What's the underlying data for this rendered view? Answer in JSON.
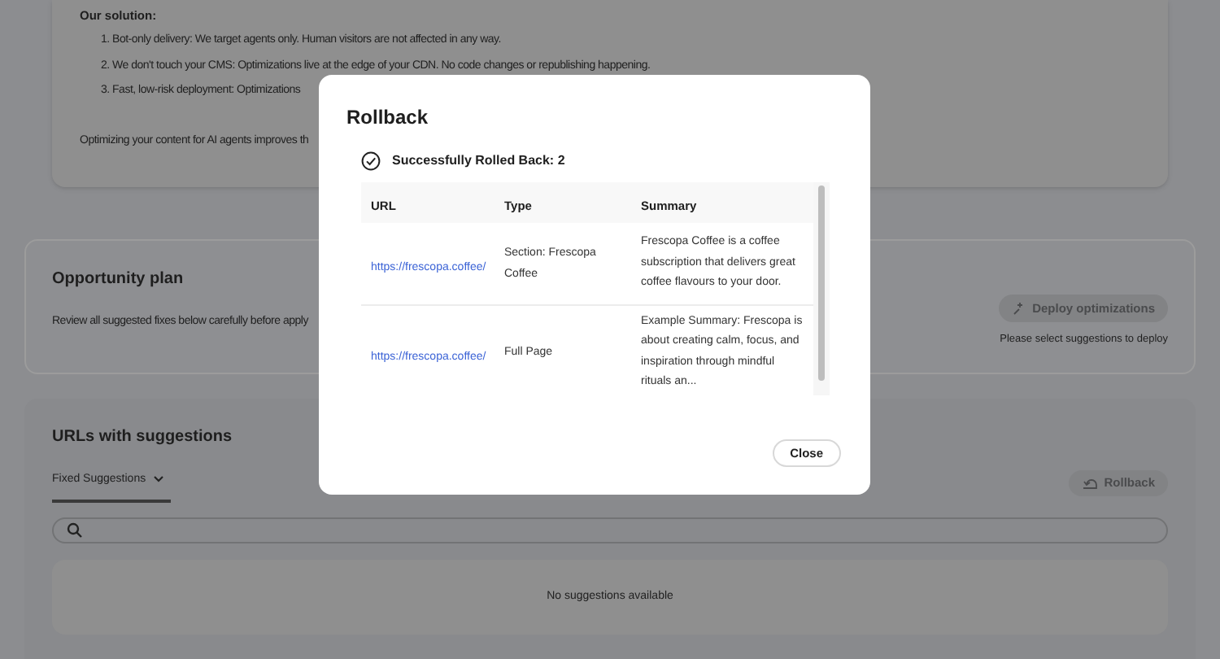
{
  "background": {
    "solution": {
      "heading": "Our solution:",
      "items": [
        "1. Bot-only delivery: We target agents only. Human visitors are not affected in any way.",
        "2. We don't touch your CMS: Optimizations live at the edge of your CDN. No code changes or republishing happening.",
        "3. Fast, low-risk deployment: Optimizations"
      ],
      "paragraph": "Optimizing your content for AI agents improves th"
    },
    "opportunity_plan": {
      "title": "Opportunity plan",
      "description": "Review all suggested fixes below carefully before apply",
      "deploy_button": {
        "label": "Deploy optimizations",
        "disabled": true
      },
      "hint": "Please select suggestions to deploy"
    },
    "urls_section": {
      "title": "URLs with suggestions",
      "tabs": [
        {
          "label": "Fixed Suggestions",
          "selected": true
        }
      ],
      "rollback_button": {
        "label": "Rollback",
        "disabled": true
      },
      "empty_message": "No suggestions available"
    }
  },
  "dialog": {
    "title": "Rollback",
    "status": "Successfully Rolled Back: 2",
    "table": {
      "columns": [
        "URL",
        "Type",
        "Summary"
      ],
      "rows": [
        {
          "url": "https://frescopa.coffee/",
          "type": "Section: Frescopa Coffee",
          "summary": "Frescopa Coffee is a coffee subscription that delivers great coffee flavours to your door."
        },
        {
          "url": "https://frescopa.coffee/",
          "type": "Full Page",
          "summary": "Example Summary: Frescopa is about creating calm, focus, and inspiration through mindful rituals an..."
        }
      ]
    },
    "close_button": "Close"
  }
}
